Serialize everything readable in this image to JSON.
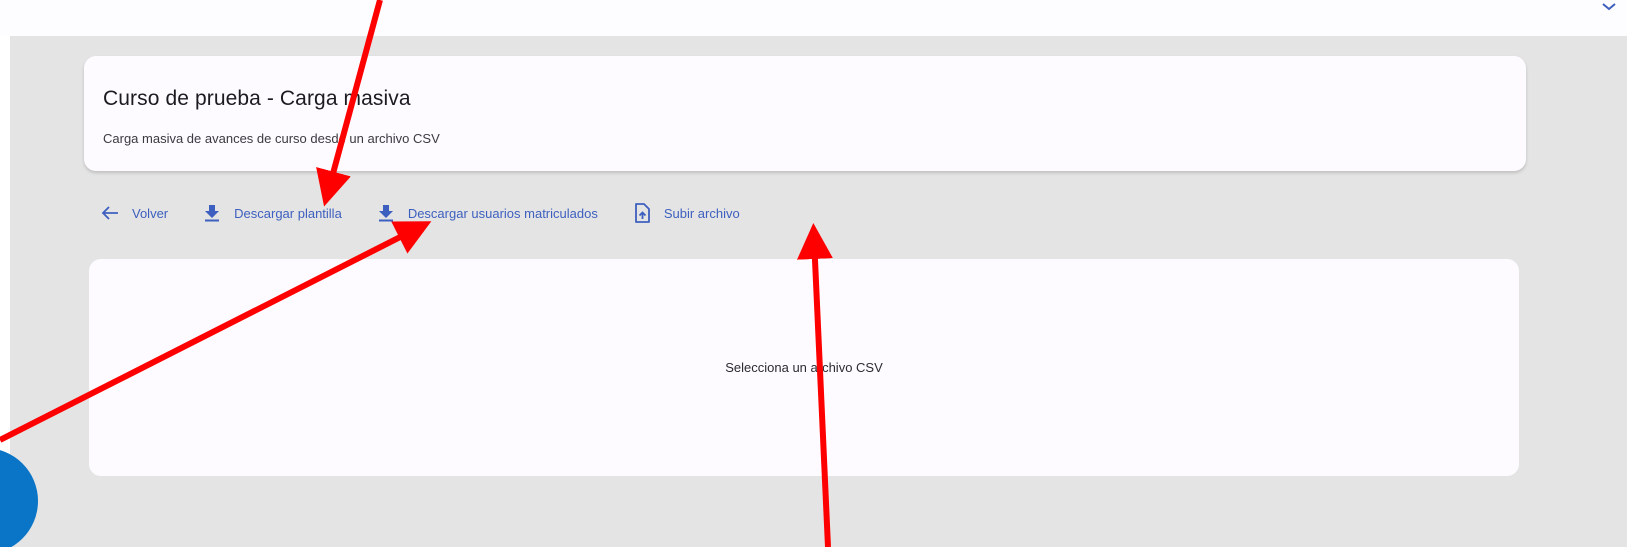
{
  "header": {
    "title": "Curso de prueba - Carga masiva",
    "subtitle": "Carga masiva de avances de curso desde un archivo CSV"
  },
  "toolbar": {
    "back_label": "Volver",
    "download_template_label": "Descargar plantilla",
    "download_users_label": "Descargar usuarios matriculados",
    "upload_label": "Subir archivo"
  },
  "drop_zone": {
    "message": "Selecciona un archivo CSV"
  },
  "colors": {
    "accent": "#3d5fbf",
    "background": "#e4e4e4",
    "card": "#fdfbff",
    "fab": "#0a74c7",
    "annotation": "#ff0000"
  },
  "icons": {
    "back": "arrow-left-icon",
    "download": "download-icon",
    "upload": "file-upload-icon",
    "collapse": "chevron-down-icon"
  }
}
